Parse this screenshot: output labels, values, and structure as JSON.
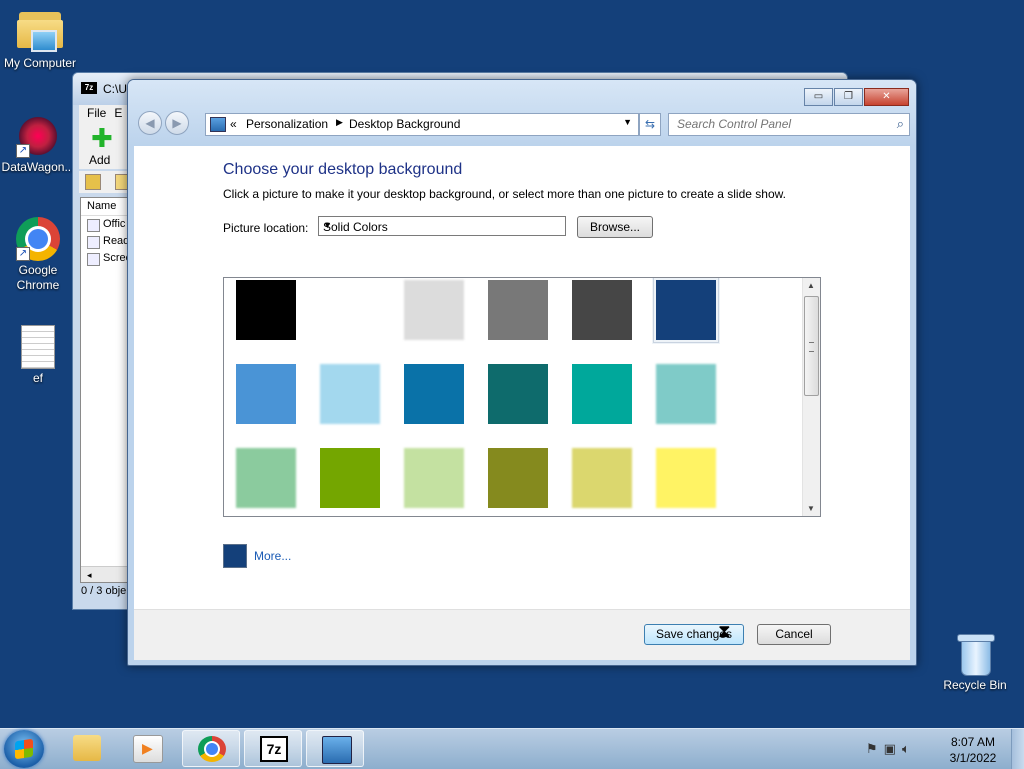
{
  "desktop": {
    "icons": [
      {
        "label": "My Computer"
      },
      {
        "label": "DataWagon..."
      },
      {
        "label": "Google Chrome"
      },
      {
        "label": "ef"
      },
      {
        "label": "Recycle Bin"
      }
    ]
  },
  "background_window": {
    "title": "C:\\U",
    "menu": [
      "File",
      "E"
    ],
    "toolbar_add": "Add",
    "list_header": "Name",
    "list_items": [
      "Offic",
      "Read",
      "Scree"
    ],
    "status": "0 / 3 obje"
  },
  "window": {
    "caption_buttons": {
      "minimize": "▭",
      "maximize": "❐",
      "close": "✕"
    },
    "address": {
      "overflow": "«",
      "crumbs": [
        "Personalization",
        "Desktop Background"
      ]
    },
    "search_placeholder": "Search Control Panel",
    "heading": "Choose your desktop background",
    "description": "Click a picture to make it your desktop background, or select more than one picture to create a slide show.",
    "picture_location_label": "Picture location:",
    "picture_location_value": "Solid Colors",
    "browse_label": "Browse...",
    "swatches": [
      "#000000",
      "#ffffff",
      "#dcdcdc",
      "#787878",
      "#464646",
      "#14407a",
      "#4a94d6",
      "#a3d8ee",
      "#0a72a8",
      "#0e6b6c",
      "#00a89b",
      "#7fcbc8",
      "#8bcb9e",
      "#74a600",
      "#c4e1a1",
      "#858a1e",
      "#dbd76e",
      "#fff364"
    ],
    "selected_swatch": "#14407a",
    "more_label": "More...",
    "save_label": "Save changes",
    "cancel_label": "Cancel"
  },
  "taskbar": {
    "time": "8:07 AM",
    "date": "3/1/2022",
    "app_7z": "7z"
  }
}
